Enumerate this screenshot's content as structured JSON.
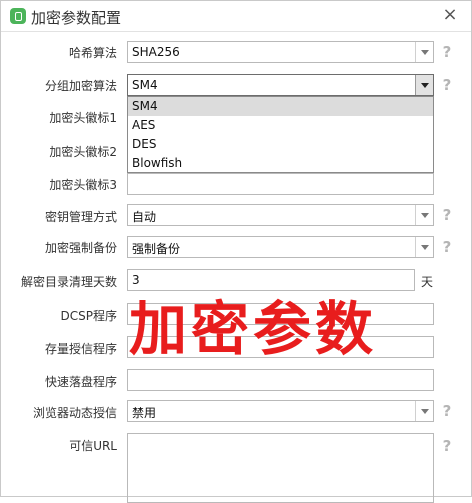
{
  "window": {
    "title": "加密参数配置",
    "close_glyph": "×"
  },
  "form": {
    "hash": {
      "label": "哈希算法",
      "value": "SHA256"
    },
    "group_alg": {
      "label": "分组加密算法",
      "value": "SM4",
      "options": [
        "SM4",
        "AES",
        "DES",
        "Blowfish"
      ],
      "selected_option": "SM4"
    },
    "header1": {
      "label": "加密头徽标1",
      "value": ""
    },
    "header2": {
      "label": "加密头徽标2",
      "value": ""
    },
    "header3": {
      "label": "加密头徽标3",
      "value": ""
    },
    "key_mgmt": {
      "label": "密钥管理方式",
      "value": "自动"
    },
    "force_backup": {
      "label": "加密强制备份",
      "value": "强制备份"
    },
    "cleanup_days": {
      "label": "解密目录清理天数",
      "value": "3",
      "unit": "天"
    },
    "dcsp": {
      "label": "DCSP程序",
      "value": ""
    },
    "storage_auth": {
      "label": "存量授信程序",
      "value": ""
    },
    "fast_save": {
      "label": "快速落盘程序",
      "value": ""
    },
    "browser_auth": {
      "label": "浏览器动态授信",
      "value": "禁用"
    },
    "trusted_url": {
      "label": "可信URL",
      "value": ""
    }
  },
  "help_glyph": "?",
  "watermark_text": "加密参数",
  "colors": {
    "watermark": "#e81d1d",
    "icon_green": "#4cb45a",
    "selected_option_bg": "#dcdcdc"
  }
}
